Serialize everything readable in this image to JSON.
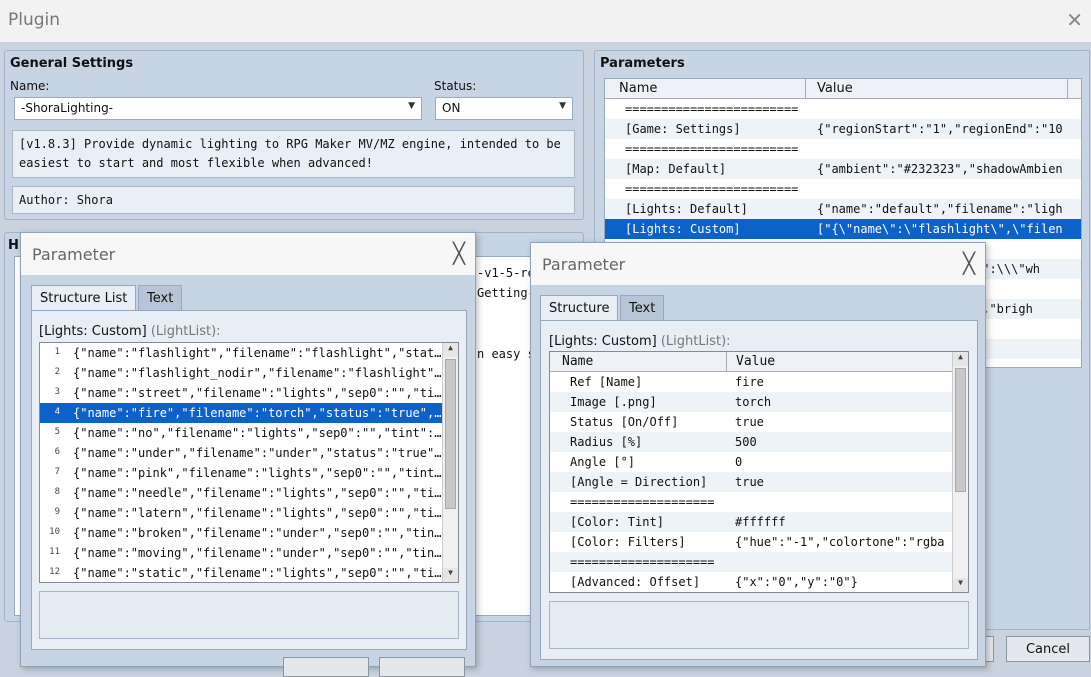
{
  "window": {
    "title": "Plugin",
    "close_glyph": "✕"
  },
  "general": {
    "heading": "General Settings",
    "name_label": "Name:",
    "name_value": "-ShoraLighting-",
    "status_label": "Status:",
    "status_value": "ON",
    "description": "[v1.8.3] Provide dynamic lighting to RPG Maker MV/MZ engine, intended to be easiest to start and most flexible when advanced!",
    "author": "Author: Shora"
  },
  "help_partial": {
    "heading": "H",
    "line1": "-v1-5-re",
    "line2": "Getting-",
    "line3": "n easy s"
  },
  "parameters": {
    "heading": "Parameters",
    "col_name": "Name",
    "col_value": "Value",
    "rows": [
      {
        "name": "========================",
        "value": ""
      },
      {
        "name": "[Game: Settings]",
        "value": "{\"regionStart\":\"1\",\"regionEnd\":\"10"
      },
      {
        "name": "========================",
        "value": ""
      },
      {
        "name": "[Map: Default]",
        "value": "{\"ambient\":\"#232323\",\"shadowAmbien"
      },
      {
        "name": "========================",
        "value": ""
      },
      {
        "name": "[Lights: Default]",
        "value": "{\"name\":\"default\",\"filename\":\"ligh"
      },
      {
        "name": "[Lights: Custom]",
        "value": "[\"{\\\"name\\\":\\\"flashlight\\\",\\\"filen"
      }
    ],
    "hidden_partial": [
      "\\\":\\\\\\\"wh",
      "\",\"brigh"
    ]
  },
  "dialog_left": {
    "title": "Parameter",
    "tab_active": "Structure List",
    "tab_inactive": "Text",
    "caption_main": "[Lights: Custom]",
    "caption_type": "(LightList):",
    "items": [
      {
        "num": "1",
        "text": "{\"name\":\"flashlight\",\"filename\":\"flashlight\",\"status"
      },
      {
        "num": "2",
        "text": "{\"name\":\"flashlight_nodir\",\"filename\":\"flashlight\",\""
      },
      {
        "num": "3",
        "text": "{\"name\":\"street\",\"filename\":\"lights\",\"sep0\":\"\",\"tint"
      },
      {
        "num": "4",
        "text": "{\"name\":\"fire\",\"filename\":\"torch\",\"status\":\"true\",\"r"
      },
      {
        "num": "5",
        "text": "{\"name\":\"no\",\"filename\":\"lights\",\"sep0\":\"\",\"tint\":\"#"
      },
      {
        "num": "6",
        "text": "{\"name\":\"under\",\"filename\":\"under\",\"status\":\"true\",\""
      },
      {
        "num": "7",
        "text": "{\"name\":\"pink\",\"filename\":\"lights\",\"sep0\":\"\",\"tint\":"
      },
      {
        "num": "8",
        "text": "{\"name\":\"needle\",\"filename\":\"lights\",\"sep0\":\"\",\"tint"
      },
      {
        "num": "9",
        "text": "{\"name\":\"latern\",\"filename\":\"lights\",\"sep0\":\"\",\"tint"
      },
      {
        "num": "10",
        "text": "{\"name\":\"broken\",\"filename\":\"under\",\"sep0\":\"\",\"tint\""
      },
      {
        "num": "11",
        "text": "{\"name\":\"moving\",\"filename\":\"under\",\"sep0\":\"\",\"tint\""
      },
      {
        "num": "12",
        "text": "{\"name\":\"static\",\"filename\":\"lights\",\"sep0\":\"\",\"tint"
      }
    ],
    "close_glyph": "╳"
  },
  "dialog_right": {
    "title": "Parameter",
    "tab_active": "Structure",
    "tab_inactive": "Text",
    "caption_main": "[Lights: Custom]",
    "caption_type": "(LightList):",
    "col_name": "Name",
    "col_value": "Value",
    "rows": [
      {
        "name": "Ref [Name]",
        "value": "fire"
      },
      {
        "name": "Image [.png]",
        "value": "torch"
      },
      {
        "name": "Status [On/Off]",
        "value": "true"
      },
      {
        "name": "Radius [%]",
        "value": "500"
      },
      {
        "name": "Angle [°]",
        "value": "0"
      },
      {
        "name": "[Angle = Direction]",
        "value": "true"
      },
      {
        "name": "====================",
        "value": ""
      },
      {
        "name": "[Color: Tint]",
        "value": "#ffffff"
      },
      {
        "name": "[Color: Filters]",
        "value": "{\"hue\":\"-1\",\"colortone\":\"rgba"
      },
      {
        "name": "====================",
        "value": ""
      },
      {
        "name": "[Advanced: Offset]",
        "value": "{\"x\":\"0\",\"y\":\"0\"}"
      }
    ],
    "close_glyph": "╳"
  },
  "footer": {
    "cancel": "Cancel"
  },
  "colors": {
    "selection": "#0c62c9",
    "panel": "#c6d4e4"
  }
}
